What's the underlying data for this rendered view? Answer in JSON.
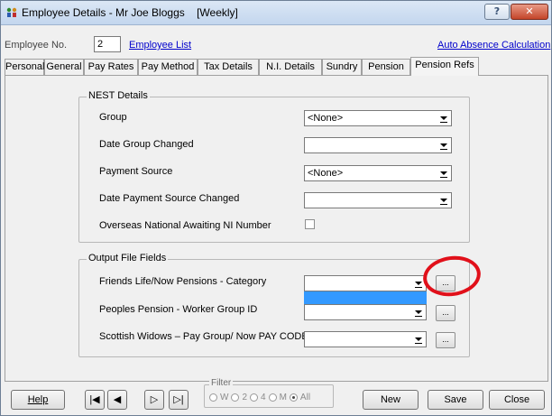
{
  "window": {
    "title": "Employee Details - Mr Joe Bloggs    [Weekly]",
    "help_label": "?",
    "close_label": "✕"
  },
  "header": {
    "employee_no_label": "Employee No.",
    "employee_no_value": "2",
    "employee_list_link": "Employee List",
    "auto_absence_link": "Auto Absence Calculation"
  },
  "tabs": [
    {
      "label": "Personal"
    },
    {
      "label": "General"
    },
    {
      "label": "Pay Rates"
    },
    {
      "label": "Pay Method"
    },
    {
      "label": "Tax Details"
    },
    {
      "label": "N.I. Details"
    },
    {
      "label": "Sundry"
    },
    {
      "label": "Pension"
    },
    {
      "label": "Pension Refs",
      "active": true
    }
  ],
  "nest": {
    "title": "NEST Details",
    "group_label": "Group",
    "group_value": "<None>",
    "date_group_changed_label": "Date Group Changed",
    "date_group_changed_value": "",
    "payment_source_label": "Payment Source",
    "payment_source_value": "<None>",
    "date_payment_source_changed_label": "Date Payment Source Changed",
    "date_payment_source_changed_value": "",
    "overseas_label": "Overseas National Awaiting NI Number",
    "overseas_checked": false
  },
  "output": {
    "title": "Output File Fields",
    "friends_life_label": "Friends Life/Now Pensions - Category",
    "friends_life_value": "",
    "peoples_pension_label": "Peoples Pension - Worker Group ID",
    "peoples_pension_value": "",
    "scottish_widows_label": "Scottish Widows – Pay Group/ Now PAY CODE",
    "scottish_widows_value": "",
    "ellipsis_label": "..."
  },
  "footer": {
    "help_label": "Help",
    "first_label": "|◀",
    "prev_label": "◀",
    "next_label": "▷",
    "last_label": "▷|",
    "filter_title": "Filter",
    "filter_options": [
      "W",
      "2",
      "4",
      "M",
      "All"
    ],
    "filter_selected": "All",
    "new_label": "New",
    "save_label": "Save",
    "close_label": "Close"
  },
  "colors": {
    "highlight": "#3399ff",
    "annotation_circle": "#e1101a",
    "link": "#0000cc"
  }
}
